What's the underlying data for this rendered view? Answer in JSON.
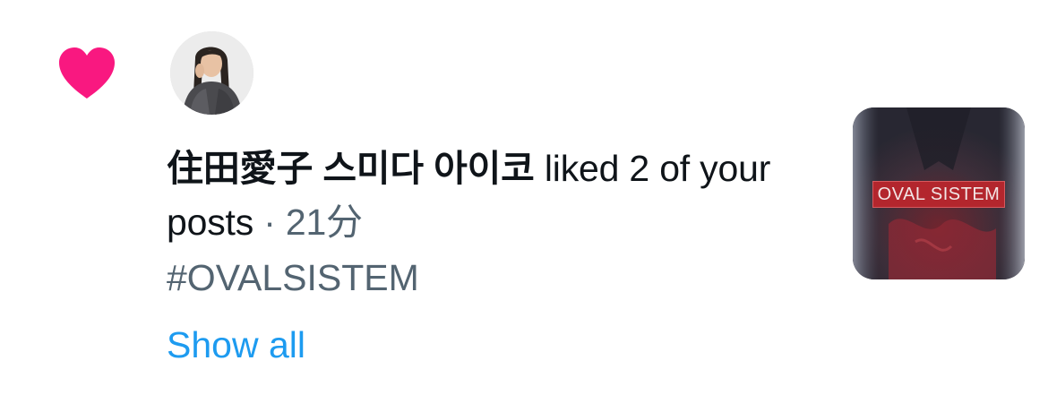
{
  "notification": {
    "user_name": "住田愛子 스미다 아이코",
    "action_text": " liked 2 of your posts",
    "separator": " · ",
    "time_ago": "21分",
    "hashtag": "#OVALSISTEM",
    "show_all_label": "Show all",
    "heart_icon": "heart-icon",
    "heart_color": "#f91880",
    "link_color": "#1d9bf0",
    "secondary_text_color": "#536471"
  },
  "thumbnail": {
    "label": "OVAL SISTEM"
  }
}
